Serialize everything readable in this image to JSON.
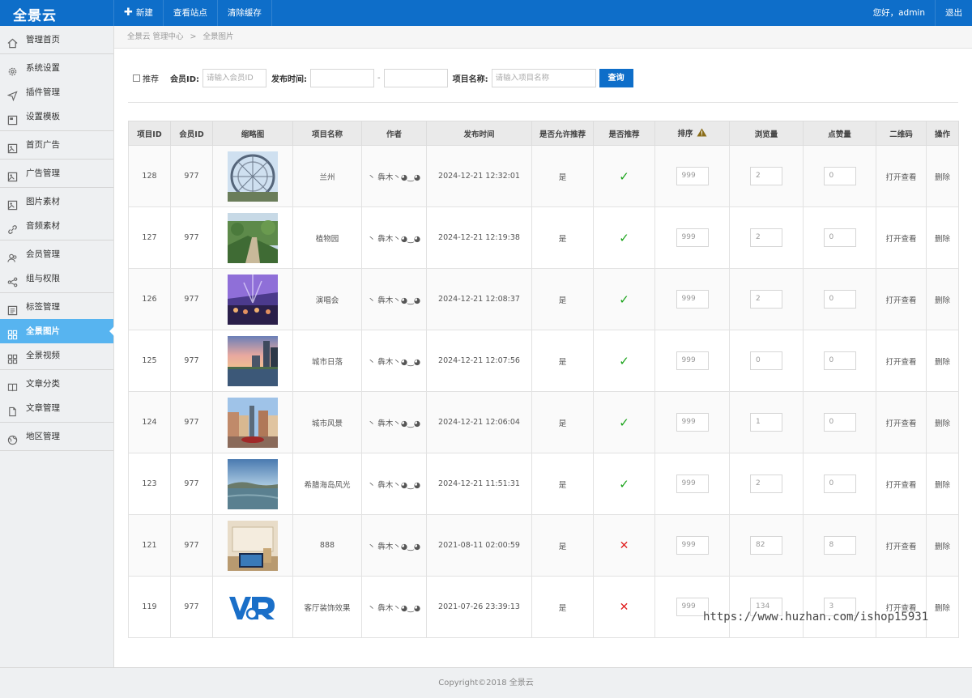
{
  "app": {
    "logo": "全景云"
  },
  "topnav": {
    "new_label": "新建",
    "view_site_label": "查看站点",
    "clear_cache_label": "清除缓存",
    "greeting": "您好，admin",
    "logout_label": "退出"
  },
  "sidebar": {
    "groups": [
      [
        {
          "label": "管理首页",
          "icon": "home-icon"
        }
      ],
      [
        {
          "label": "系统设置",
          "icon": "gear-icon"
        },
        {
          "label": "插件管理",
          "icon": "plugin-icon"
        },
        {
          "label": "设置模板",
          "icon": "template-icon"
        }
      ],
      [
        {
          "label": "首页广告",
          "icon": "image-icon"
        }
      ],
      [
        {
          "label": "广告管理",
          "icon": "image-icon"
        }
      ],
      [
        {
          "label": "图片素材",
          "icon": "image-icon"
        },
        {
          "label": "音频素材",
          "icon": "link-icon"
        }
      ],
      [
        {
          "label": "会员管理",
          "icon": "users-icon"
        },
        {
          "label": "组与权限",
          "icon": "share-icon"
        }
      ],
      [
        {
          "label": "标签管理",
          "icon": "list-icon"
        },
        {
          "label": "全景图片",
          "icon": "grid-icon",
          "active": true
        },
        {
          "label": "全景视频",
          "icon": "grid-icon"
        }
      ],
      [
        {
          "label": "文章分类",
          "icon": "book-icon"
        },
        {
          "label": "文章管理",
          "icon": "file-icon"
        }
      ],
      [
        {
          "label": "地区管理",
          "icon": "globe-icon"
        }
      ]
    ]
  },
  "breadcrumb": {
    "root": "全景云 管理中心",
    "separator": ">",
    "current": "全景图片"
  },
  "filter": {
    "recommend_label": "推荐",
    "member_id_label": "会员ID:",
    "member_id_placeholder": "请输入会员ID",
    "publish_time_label": "发布时间:",
    "range_separator": "-",
    "project_name_label": "项目名称:",
    "project_name_placeholder": "请输入项目名称",
    "query_label": "查询"
  },
  "table": {
    "headers": [
      "项目ID",
      "会员ID",
      "缩略图",
      "项目名称",
      "作者",
      "发布时间",
      "是否允许推荐",
      "是否推荐",
      "排序",
      "浏览量",
      "点赞量",
      "二维码",
      "操作"
    ],
    "open_label": "打开查看",
    "delete_label": "删除",
    "check_glyph": "✓",
    "cross_glyph": "✕",
    "rows": [
      {
        "id": "128",
        "member_id": "977",
        "name": "兰州",
        "author": "丶 犇木丶◕‿◕",
        "time": "2024-12-21 12:32:01",
        "allow": "是",
        "recommended": true,
        "sort": "999",
        "views": "2",
        "likes": "0",
        "thumb": "ferris-wheel"
      },
      {
        "id": "127",
        "member_id": "977",
        "name": "植物园",
        "author": "丶 犇木丶◕‿◕",
        "time": "2024-12-21 12:19:38",
        "allow": "是",
        "recommended": true,
        "sort": "999",
        "views": "2",
        "likes": "0",
        "thumb": "garden"
      },
      {
        "id": "126",
        "member_id": "977",
        "name": "演唱会",
        "author": "丶 犇木丶◕‿◕",
        "time": "2024-12-21 12:08:37",
        "allow": "是",
        "recommended": true,
        "sort": "999",
        "views": "2",
        "likes": "0",
        "thumb": "concert"
      },
      {
        "id": "125",
        "member_id": "977",
        "name": "城市日落",
        "author": "丶 犇木丶◕‿◕",
        "time": "2024-12-21 12:07:56",
        "allow": "是",
        "recommended": true,
        "sort": "999",
        "views": "0",
        "likes": "0",
        "thumb": "sunset"
      },
      {
        "id": "124",
        "member_id": "977",
        "name": "城市风景",
        "author": "丶 犇木丶◕‿◕",
        "time": "2024-12-21 12:06:04",
        "allow": "是",
        "recommended": true,
        "sort": "999",
        "views": "1",
        "likes": "0",
        "thumb": "city"
      },
      {
        "id": "123",
        "member_id": "977",
        "name": "希腊海岛风光",
        "author": "丶 犇木丶◕‿◕",
        "time": "2024-12-21 11:51:31",
        "allow": "是",
        "recommended": true,
        "sort": "999",
        "views": "2",
        "likes": "0",
        "thumb": "island"
      },
      {
        "id": "121",
        "member_id": "977",
        "name": "888",
        "author": "丶 犇木丶◕‿◕",
        "time": "2021-08-11 02:00:59",
        "allow": "是",
        "recommended": false,
        "sort": "999",
        "views": "82",
        "likes": "8",
        "thumb": "room"
      },
      {
        "id": "119",
        "member_id": "977",
        "name": "客厅装饰效果",
        "author": "丶 犇木丶◕‿◕",
        "time": "2021-07-26 23:39:13",
        "allow": "是",
        "recommended": false,
        "sort": "999",
        "views": "134",
        "likes": "3",
        "thumb": "vr-logo"
      }
    ]
  },
  "watermark": "https://www.huzhan.com/ishop15931",
  "footer": {
    "text": "Copyright©2018   全景云"
  },
  "colors": {
    "primary": "#0e6ec9",
    "sidebar_active": "#57b4f0",
    "check": "#1aa31a",
    "cross": "#e02020"
  }
}
